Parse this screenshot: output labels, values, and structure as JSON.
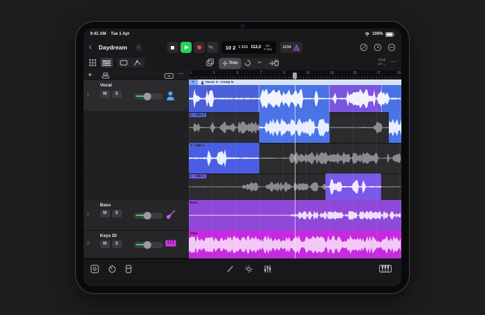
{
  "status_bar": {
    "time": "9:41 AM",
    "date": "Tue 1 Apr",
    "battery_level": "100%"
  },
  "toolbar": {
    "project_title": "Daydream",
    "lcd": {
      "position": "10 2",
      "ticks": "1 631",
      "tempo": "112,0",
      "time_signature": "4/4",
      "key": "C maj"
    },
    "count_in": "1234"
  },
  "tool_row": {
    "trim": "Trim",
    "snap_label": "Snap",
    "snap_value": "1/4"
  },
  "track_headers": [
    {
      "number": "1",
      "name": "Vocal",
      "mute": "M",
      "solo": "S"
    },
    {
      "number": "2",
      "name": "Bass",
      "mute": "M",
      "solo": "S"
    },
    {
      "number": "3",
      "name": "Keys DI",
      "mute": "M",
      "solo": "S"
    }
  ],
  "arrangement": {
    "ruler_bars": [
      "1",
      "3",
      "5",
      "7",
      "9",
      "11",
      "13",
      "15",
      "17",
      "19"
    ],
    "take_folder_label": "Vocal: 2 - Comp D",
    "take_lanes": [
      {
        "label": "3 - Take 3"
      },
      {
        "label": "2 - Take 2"
      },
      {
        "label": "1 - Take 1"
      }
    ],
    "bass_region_label": "Bass",
    "keys_region_label": "Keys"
  },
  "colors": {
    "play_green": "#2bd158",
    "record_red": "#ff453a",
    "metronome_purple": "#bf5af2",
    "accent_blue": "#3f8ef7",
    "comp_blue": "#4a60d8",
    "take3_blue": "#4a74e8",
    "take2_blue": "#4a5ee4",
    "take1_violet": "#7a58e8",
    "bass_purple": "#9048d8",
    "keys_magenta": "#c62ae0"
  }
}
